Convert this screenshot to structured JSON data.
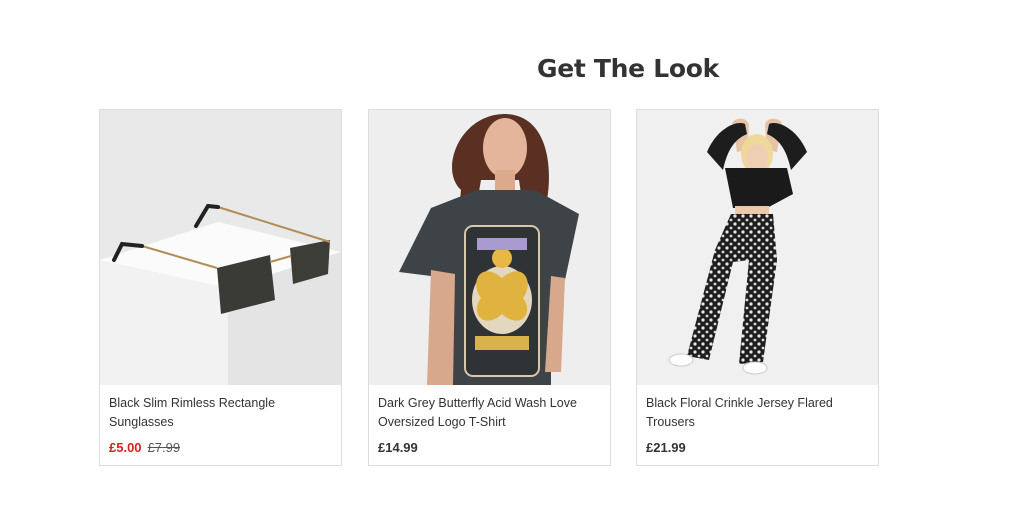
{
  "section": {
    "title": "Get The Look"
  },
  "products": [
    {
      "name": "Black Slim Rimless Rectangle Sunglasses",
      "price": "£5.00",
      "was_price": "£7.99",
      "on_sale": true,
      "image_icon": "sunglasses-image"
    },
    {
      "name": "Dark Grey Butterfly Acid Wash Love Oversized Logo T-Shirt",
      "price": "£14.99",
      "image_icon": "tshirt-model-image"
    },
    {
      "name": "Black Floral Crinkle Jersey Flared Trousers",
      "price": "£21.99",
      "image_icon": "trousers-model-image"
    }
  ],
  "colors": {
    "sale": "#d5231b",
    "text": "#333333",
    "border": "#dddddd"
  }
}
